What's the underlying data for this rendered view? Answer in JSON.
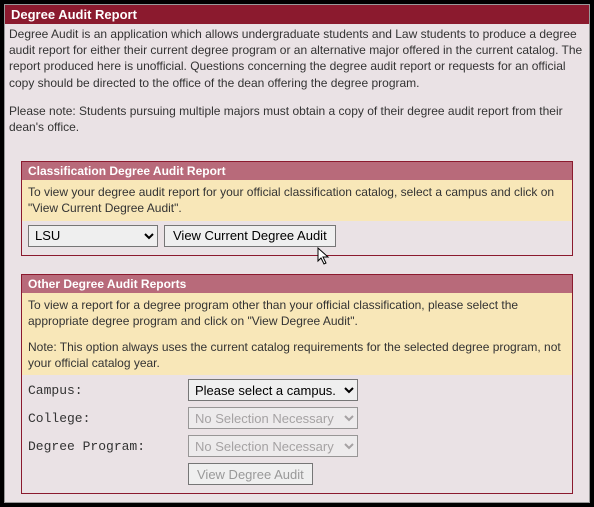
{
  "header": {
    "title": "Degree Audit Report"
  },
  "intro": {
    "p1": "Degree Audit is an application which allows undergraduate students and Law students to produce a degree audit report for either their current degree program or an alternative major offered in the current catalog. The report produced here is unofficial. Questions concerning the degree audit report or requests for an official copy should be directed to the office of the dean offering the degree program.",
    "p2": "Please note: Students pursuing multiple majors must obtain a copy of their degree audit report from their dean's office."
  },
  "panel1": {
    "title": "Classification Degree Audit Report",
    "desc": "To view your degree audit report for your official classification catalog, select a campus and click on \"View Current Degree Audit\".",
    "campus_selected": "LSU",
    "button": "View Current Degree Audit"
  },
  "panel2": {
    "title": "Other Degree Audit Reports",
    "desc1": "To view a report for a degree program other than your official classification, please select the appropriate degree program and click on \"View Degree Audit\".",
    "desc2": "Note: This option always uses the current catalog requirements for the selected degree program, not your official catalog year.",
    "labels": {
      "campus": "Campus:",
      "college": "College:",
      "program": "Degree Program:"
    },
    "campus_selected": "Please select a campus.",
    "college_selected": "No Selection Necessary",
    "program_selected": "No Selection Necessary",
    "button": "View Degree Audit"
  }
}
